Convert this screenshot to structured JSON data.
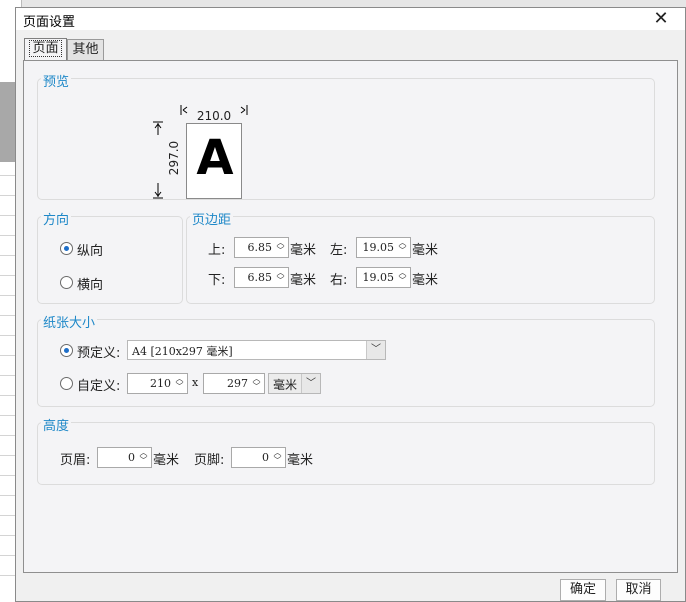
{
  "dialog": {
    "title": "页面设置",
    "close_glyph": "✕"
  },
  "tabs": [
    {
      "label": "页面"
    },
    {
      "label": "其他"
    }
  ],
  "preview": {
    "title": "预览",
    "paper_letter": "A",
    "width_label": "210.0",
    "height_label": "297.0"
  },
  "orientation": {
    "title": "方向",
    "portrait": "纵向",
    "landscape": "横向",
    "selected": "portrait"
  },
  "margins": {
    "title": "页边距",
    "top_label": "上:",
    "top_value": "6.85",
    "bottom_label": "下:",
    "bottom_value": "6.85",
    "left_label": "左:",
    "left_value": "19.05",
    "right_label": "右:",
    "right_value": "19.05",
    "unit": "毫米"
  },
  "paper_size": {
    "title": "纸张大小",
    "predefined_label": "预定义:",
    "predefined_value": "A4 [210x297 毫米]",
    "custom_label": "自定义:",
    "custom_width": "210",
    "times": "x",
    "custom_height": "297",
    "unit_value": "毫米",
    "selected": "predefined"
  },
  "height": {
    "title": "高度",
    "header_label": "页眉:",
    "header_value": "0",
    "footer_label": "页脚:",
    "footer_value": "0",
    "unit": "毫米"
  },
  "buttons": {
    "ok": "确定",
    "cancel": "取消"
  },
  "colors": {
    "accent": "#1e88c8",
    "radio_dot": "#1e6ec8"
  }
}
